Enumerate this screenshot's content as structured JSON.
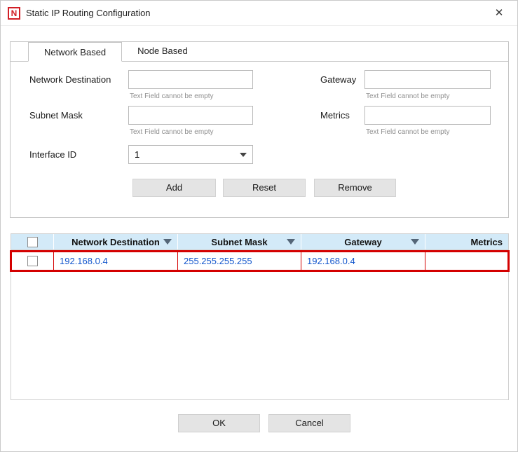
{
  "window": {
    "title": "Static IP Routing Configuration",
    "logo_letter": "N",
    "close_glyph": "✕"
  },
  "tabs": [
    {
      "label": "Network Based",
      "active": true
    },
    {
      "label": "Node Based",
      "active": false
    }
  ],
  "form": {
    "network_destination": {
      "label": "Network Destination",
      "value": "",
      "hint": "Text Field cannot be empty"
    },
    "gateway": {
      "label": "Gateway",
      "value": "",
      "hint": "Text Field cannot be empty"
    },
    "subnet_mask": {
      "label": "Subnet Mask",
      "value": "",
      "hint": "Text Field cannot be empty"
    },
    "metrics": {
      "label": "Metrics",
      "value": "",
      "hint": "Text Field cannot be empty"
    },
    "interface_id": {
      "label": "Interface ID",
      "value": "1"
    },
    "buttons": {
      "add": "Add",
      "reset": "Reset",
      "remove": "Remove"
    }
  },
  "table": {
    "columns": [
      "Network Destination",
      "Subnet Mask",
      "Gateway",
      "Metrics"
    ],
    "rows": [
      {
        "network_destination": "192.168.0.4",
        "subnet_mask": "255.255.255.255",
        "gateway": "192.168.0.4",
        "metrics": ""
      }
    ]
  },
  "footer": {
    "ok": "OK",
    "cancel": "Cancel"
  },
  "colors": {
    "table_header_bg": "#d3eaf8",
    "row_text_blue": "#1155cc",
    "highlight_red": "#d40000",
    "logo_red": "#d21f26"
  }
}
